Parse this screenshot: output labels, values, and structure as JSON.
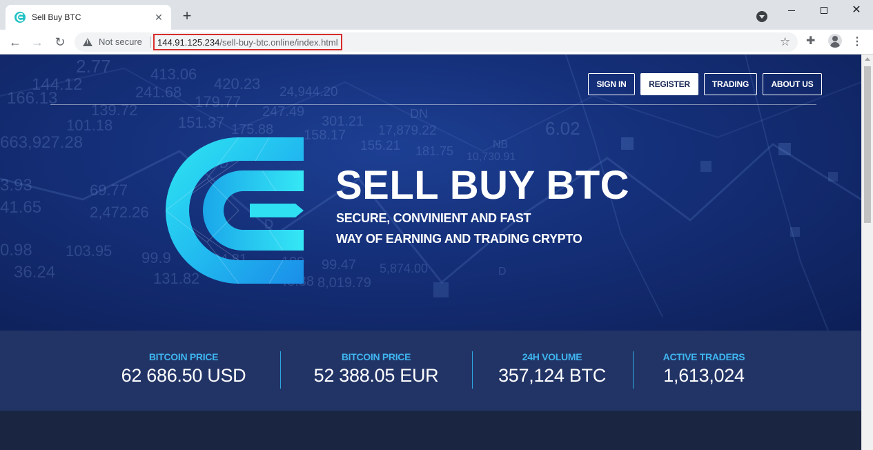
{
  "browser": {
    "tab_title": "Sell Buy BTC",
    "new_tab": "+",
    "security_label": "Not secure",
    "url_host": "144.91.125.234",
    "url_path": "/sell-buy-btc.online/index.html"
  },
  "nav": {
    "items": [
      {
        "label": "SIGN IN",
        "active": false
      },
      {
        "label": "REGISTER",
        "active": true
      },
      {
        "label": "TRADING",
        "active": false
      },
      {
        "label": "ABOUT US",
        "active": false
      }
    ]
  },
  "hero": {
    "title": "SELL BUY BTC",
    "tagline_1": "SECURE, CONVINIENT AND FAST",
    "tagline_2": "WAY OF EARNING AND TRADING CRYPTO"
  },
  "stats": [
    {
      "label": "BITCOIN PRICE",
      "value": "62 686.50 USD"
    },
    {
      "label": "BITCOIN PRICE",
      "value": "52 388.05 EUR"
    },
    {
      "label": "24H VOLUME",
      "value": "357,124 BTC"
    },
    {
      "label": "ACTIVE TRADERS",
      "value": "1,613,024"
    }
  ],
  "background_numbers": [
    "2.77",
    "413.06",
    "420.23",
    "24,944.20",
    "144.12",
    "241.68",
    "179.77",
    "166.13",
    "139.72",
    "151.37",
    "247.49",
    "301.21",
    "DN",
    "101.18",
    "175.88",
    "158.17",
    "17,879.22",
    "663,927.28",
    "155.21",
    "181.75",
    "10,730.91",
    "NB",
    "3.93",
    "69.77",
    "41.65",
    "2,472.26",
    "0.98",
    "103.95",
    "99.9",
    "84.81",
    "109",
    "99.47",
    "5,874.00",
    "36.24",
    "131.82",
    "48.88",
    "8,019.79",
    "D",
    "D",
    "D",
    "6.02"
  ],
  "colors": {
    "hero_bg": "#15307a",
    "stats_bg": "#223466",
    "stat_label": "#3fb6f0",
    "logo_cyan": "#22d3ee",
    "url_highlight": "#d92b2b"
  },
  "icons": [
    "tab-favicon-icon",
    "close-icon",
    "plus-icon",
    "tab-search-icon",
    "minimize-icon",
    "maximize-icon",
    "window-close-icon",
    "back-arrow-icon",
    "forward-arrow-icon",
    "reload-icon",
    "warning-icon",
    "star-icon",
    "extensions-icon",
    "profile-icon",
    "kebab-menu-icon"
  ]
}
